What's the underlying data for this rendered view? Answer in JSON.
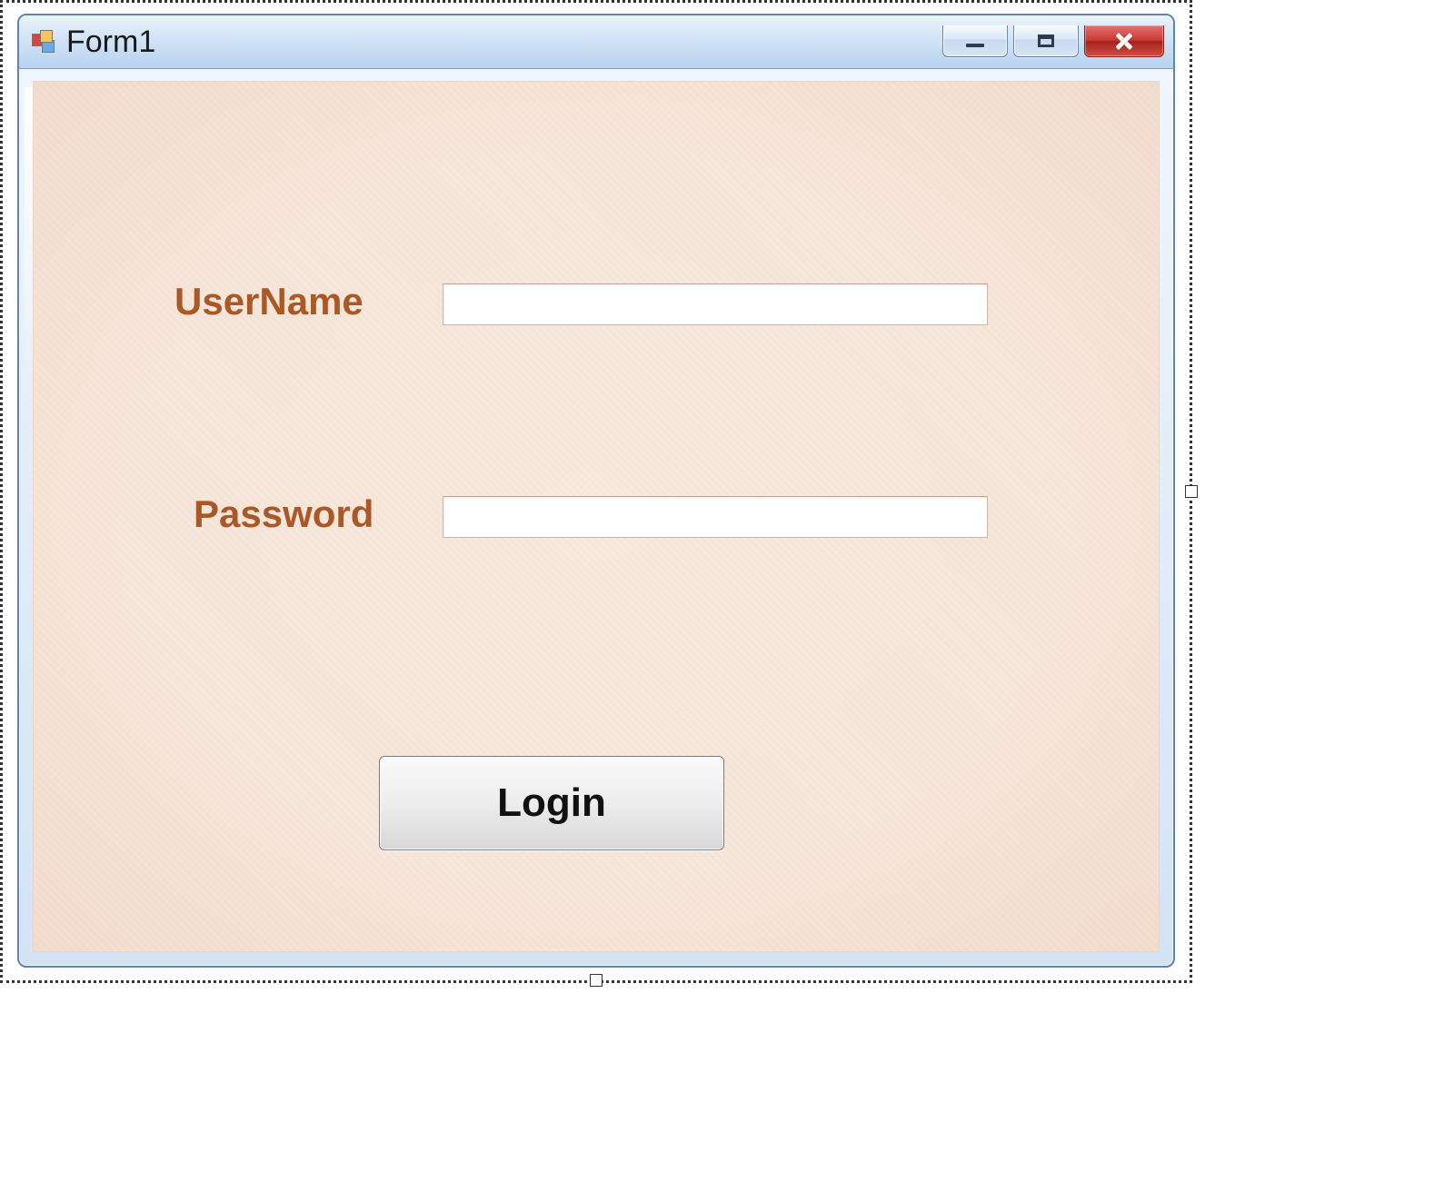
{
  "window": {
    "title": "Form1",
    "controls": {
      "minimize": "minimize",
      "maximize": "maximize",
      "close": "close"
    }
  },
  "form": {
    "labels": {
      "username": "UserName",
      "password": "Password"
    },
    "inputs": {
      "username_value": "",
      "password_value": ""
    },
    "buttons": {
      "login": "Login"
    }
  }
}
